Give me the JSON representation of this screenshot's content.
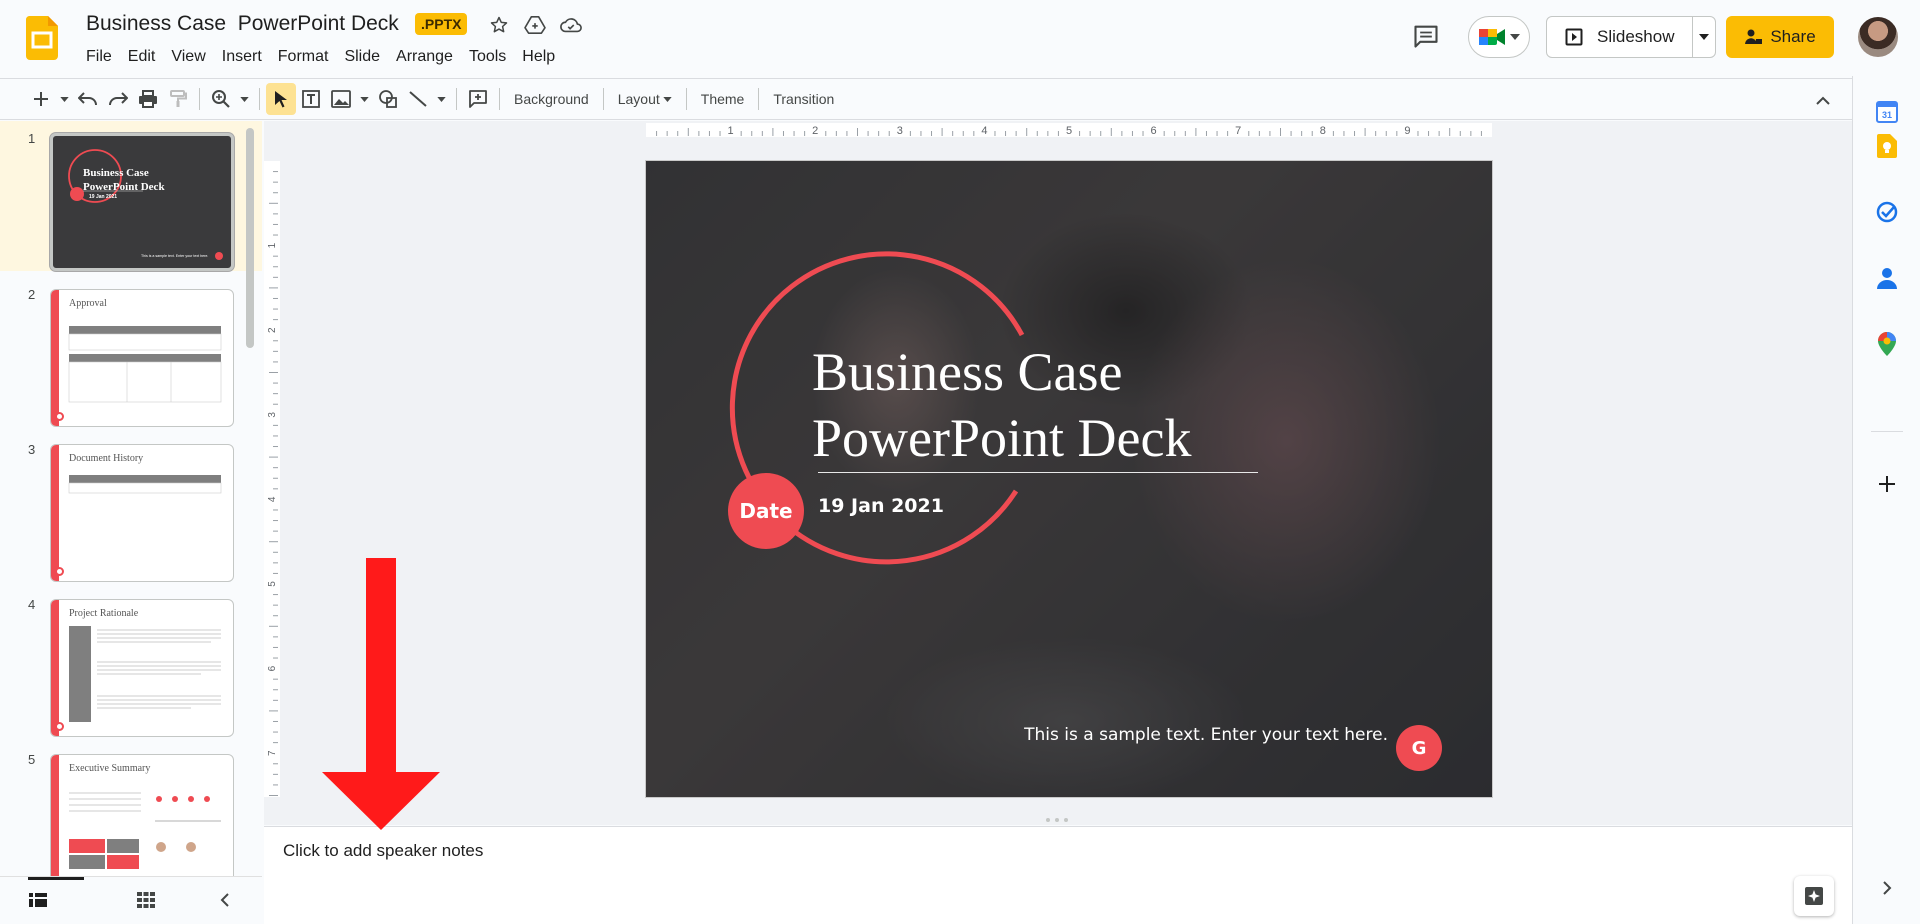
{
  "document": {
    "title": "Business Case  PowerPoint Deck",
    "badge": ".PPTX"
  },
  "menu": [
    "File",
    "Edit",
    "View",
    "Insert",
    "Format",
    "Slide",
    "Arrange",
    "Tools",
    "Help"
  ],
  "header": {
    "slideshow_label": "Slideshow",
    "share_label": "Share"
  },
  "toolbar": {
    "background_label": "Background",
    "layout_label": "Layout",
    "theme_label": "Theme",
    "transition_label": "Transition"
  },
  "filmstrip": {
    "slides": [
      {
        "number": "1",
        "title": "Business Case PowerPoint Deck",
        "selected": true
      },
      {
        "number": "2",
        "title": "Approval"
      },
      {
        "number": "3",
        "title": "Document History"
      },
      {
        "number": "4",
        "title": "Project Rationale"
      },
      {
        "number": "5",
        "title": "Executive Summary"
      }
    ]
  },
  "ruler": {
    "top_marks": [
      "1",
      "2",
      "3",
      "4",
      "5",
      "6",
      "7",
      "8",
      "9"
    ],
    "left_marks": [
      "1",
      "2",
      "3",
      "4",
      "5",
      "6",
      "7"
    ]
  },
  "slide": {
    "title_line1": "Business Case",
    "title_line2": "PowerPoint Deck",
    "date_badge": "Date",
    "date_text": "19 Jan 2021",
    "sample_text": "This is a sample text. Enter your text here.",
    "g_badge": "G",
    "accent_color": "#ef4b52"
  },
  "notes": {
    "placeholder": "Click to add speaker notes"
  },
  "sidepanel_icons": [
    "calendar-icon",
    "keep-icon",
    "tasks-icon",
    "contacts-icon",
    "maps-icon",
    "add-icon"
  ],
  "colors": {
    "brand": "#fbbc04",
    "annotation_arrow": "#ff1a1a"
  }
}
